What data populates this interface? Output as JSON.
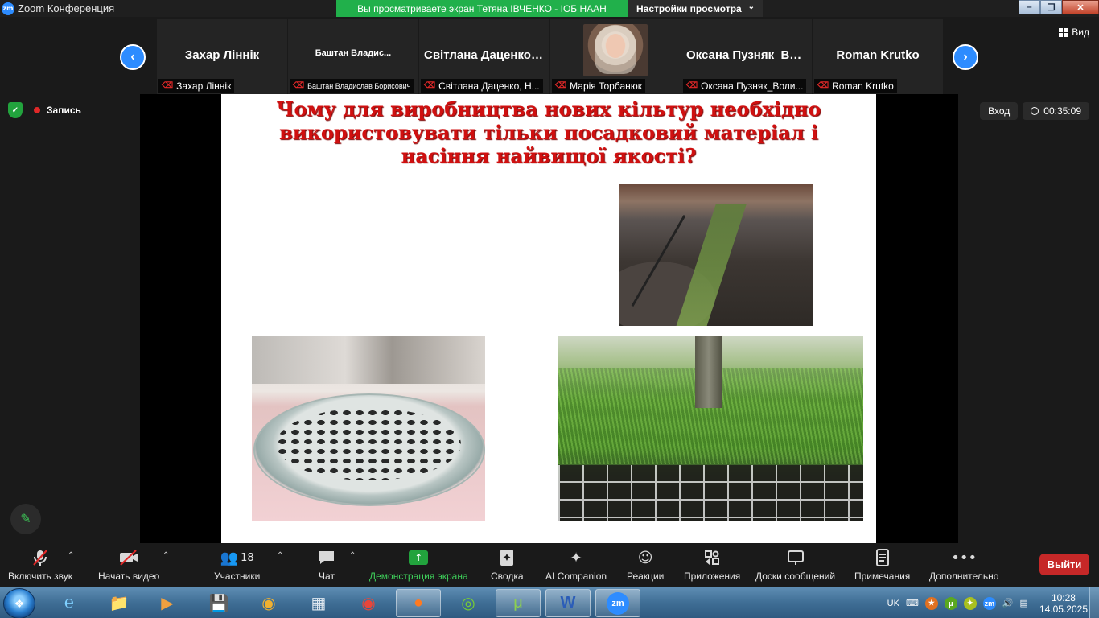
{
  "window": {
    "app_icon_text": "zm",
    "title": "Zoom Конференция",
    "share_banner": "Вы просматриваете экран Тетяна ІВЧЕНКО - ІОБ НААН",
    "view_settings": "Настройки просмотра"
  },
  "gallery": {
    "view_label": "Вид",
    "tiles": [
      {
        "big": "Захар Лiннiк",
        "small": "Захар Лiннiк"
      },
      {
        "big": "Баштан  Владис...",
        "small": "Баштан Владислав Борисович"
      },
      {
        "big": "Світлана  Даценко, Н...",
        "small": "Світлана Даценко, Н..."
      },
      {
        "big": "",
        "small": "Марія Торбанюк"
      },
      {
        "big": "Оксана  Пузняк_Воли...",
        "small": "Оксана Пузняк_Воли..."
      },
      {
        "big": "Roman Krutko",
        "small": "Roman Krutko"
      }
    ]
  },
  "meeting": {
    "record_label": "Запись",
    "entry_label": "Вход",
    "timer": "00:35:09"
  },
  "slide": {
    "title_lines": [
      "Чому для виробництва нових кільтур необхідно",
      "використовувати тільки посадковий матеріал і",
      "насіння  найвищої якості?"
    ]
  },
  "toolbar": {
    "audio": "Включить звук",
    "video": "Начать видео",
    "participants": "Участники",
    "participants_count": "18",
    "chat": "Чат",
    "share": "Демонстрация экрана",
    "summary": "Сводка",
    "ai": "AI Companion",
    "reactions": "Реакции",
    "apps": "Приложения",
    "boards": "Доски сообщений",
    "notes": "Примечания",
    "more": "Дополнительно",
    "leave": "Выйти"
  },
  "taskbar": {
    "lang": "UK",
    "time": "10:28",
    "date": "14.05.2025"
  },
  "colors": {
    "accent_blue": "#2d8cff",
    "share_green": "#21b04b",
    "leave_red": "#c62828",
    "title_red": "#d01010"
  }
}
